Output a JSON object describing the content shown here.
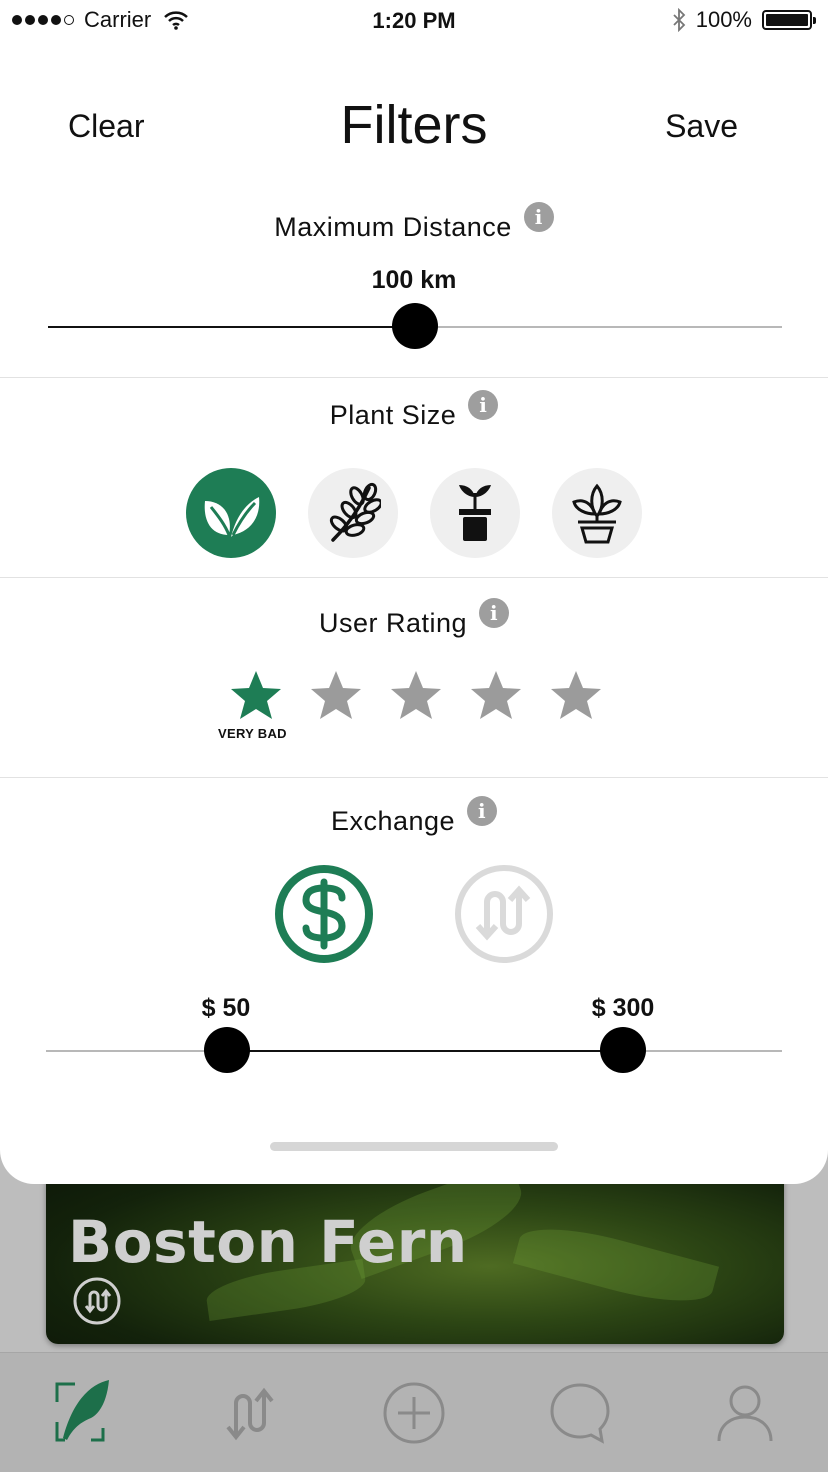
{
  "status_bar": {
    "carrier": "Carrier",
    "time": "1:20 PM",
    "battery": "100%",
    "battery_level": 1.0,
    "signal_bars_filled": 4,
    "signal_bars_total": 5
  },
  "header": {
    "clear_label": "Clear",
    "title": "Filters",
    "save_label": "Save"
  },
  "distance": {
    "title": "Maximum Distance",
    "value_label": "100 km",
    "value": 100,
    "info_icon": "i"
  },
  "plant_size": {
    "title": "Plant Size",
    "info_icon": "i",
    "options": [
      {
        "icon": "sprout-leaves-icon",
        "selected": true
      },
      {
        "icon": "branch-icon",
        "selected": false
      },
      {
        "icon": "small-potted-plant-icon",
        "selected": false
      },
      {
        "icon": "large-potted-plant-icon",
        "selected": false
      }
    ]
  },
  "user_rating": {
    "title": "User Rating",
    "info_icon": "i",
    "selected": 1,
    "max": 5,
    "caption": "VERY BAD"
  },
  "exchange": {
    "title": "Exchange",
    "info_icon": "i",
    "options": [
      {
        "icon": "dollar-icon",
        "selected": true
      },
      {
        "icon": "swap-icon",
        "selected": false
      }
    ],
    "min_label": "$ 50",
    "max_label": "$ 300",
    "min": 50,
    "max": 300
  },
  "background": {
    "card_title": "Boston Fern",
    "card_icon": "swap-icon",
    "tabs": [
      {
        "icon": "feather-icon",
        "active": true
      },
      {
        "icon": "swap-icon",
        "active": false
      },
      {
        "icon": "add-icon",
        "active": false
      },
      {
        "icon": "chat-icon",
        "active": false
      },
      {
        "icon": "profile-icon",
        "active": false
      }
    ]
  },
  "colors": {
    "accent": "#1e7d55",
    "inactive_star": "#9b9b9b",
    "inactive_button": "#efefef"
  }
}
